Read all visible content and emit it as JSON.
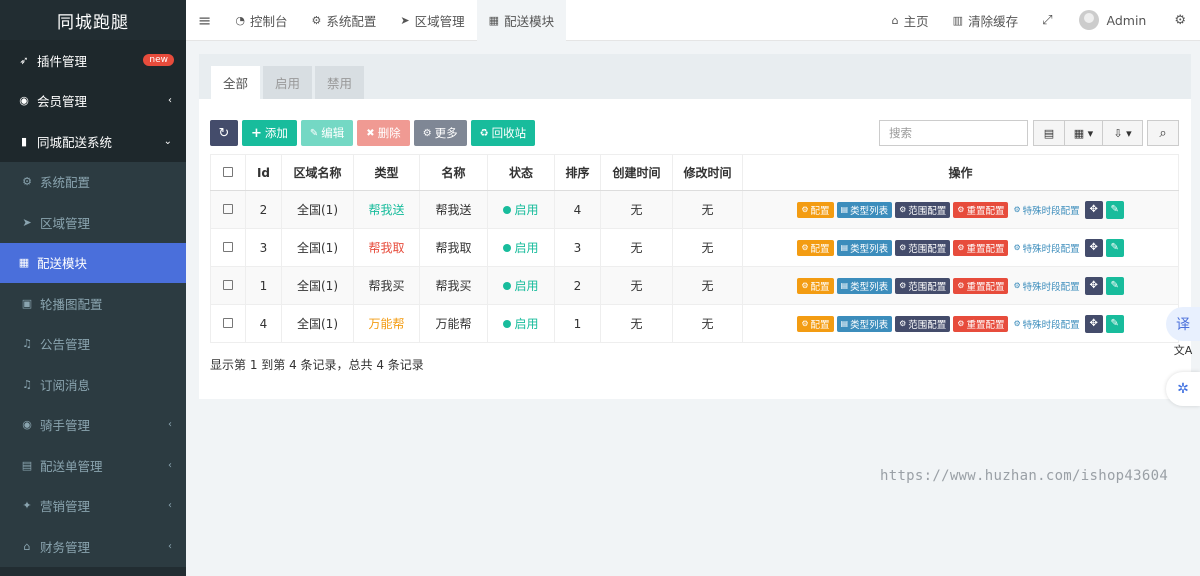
{
  "sidebar": {
    "brand": "同城跑腿",
    "items": [
      {
        "label": "插件管理",
        "icon": "rocket-icon",
        "glyph": "➶",
        "badge": "new",
        "kind": "top"
      },
      {
        "label": "会员管理",
        "icon": "user-circle-icon",
        "glyph": "◉",
        "arrow": "‹",
        "kind": "top"
      },
      {
        "label": "同城配送系统",
        "icon": "mobile-icon",
        "glyph": "▮",
        "arrow": "⌄",
        "kind": "top"
      },
      {
        "label": "系统配置",
        "icon": "gears-icon",
        "glyph": "⚙",
        "kind": "sub"
      },
      {
        "label": "区域管理",
        "icon": "location-arrow-icon",
        "glyph": "➤",
        "kind": "sub"
      },
      {
        "label": "配送模块",
        "icon": "grid-icon",
        "glyph": "▦",
        "kind": "active"
      },
      {
        "label": "轮播图配置",
        "icon": "image-icon",
        "glyph": "▣",
        "kind": "sub"
      },
      {
        "label": "公告管理",
        "icon": "bell-icon",
        "glyph": "♫",
        "kind": "sub"
      },
      {
        "label": "订阅消息",
        "icon": "bell-icon",
        "glyph": "♫",
        "kind": "sub"
      },
      {
        "label": "骑手管理",
        "icon": "user-circle-icon",
        "glyph": "◉",
        "arrow": "‹",
        "kind": "sub"
      },
      {
        "label": "配送单管理",
        "icon": "list-alt-icon",
        "glyph": "▤",
        "arrow": "‹",
        "kind": "sub"
      },
      {
        "label": "营销管理",
        "icon": "gift-icon",
        "glyph": "✦",
        "arrow": "‹",
        "kind": "sub"
      },
      {
        "label": "财务管理",
        "icon": "bank-icon",
        "glyph": "⌂",
        "arrow": "‹",
        "kind": "sub"
      }
    ]
  },
  "topbar": {
    "menu_glyph": "≡",
    "tabs": [
      {
        "label": "控制台",
        "icon": "dashboard-icon",
        "glyph": "◔"
      },
      {
        "label": "系统配置",
        "icon": "gears-icon",
        "glyph": "⚙"
      },
      {
        "label": "区域管理",
        "icon": "location-arrow-icon",
        "glyph": "➤"
      },
      {
        "label": "配送模块",
        "icon": "grid-icon",
        "glyph": "▦",
        "active": true
      }
    ],
    "home_label": "主页",
    "home_glyph": "⌂",
    "clear_cache_label": "清除缓存",
    "clear_cache_glyph": "▥",
    "fullscreen_glyph": "⤢",
    "user_name": "Admin",
    "settings_glyph": "⚙"
  },
  "filter_tabs": [
    "全部",
    "启用",
    "禁用"
  ],
  "toolbar": {
    "refresh_glyph": "↻",
    "add_label": "添加",
    "add_glyph": "+",
    "edit_label": "编辑",
    "edit_glyph": "✎",
    "delete_label": "删除",
    "delete_glyph": "✖",
    "more_label": "更多",
    "more_glyph": "⚙",
    "recycle_label": "回收站",
    "recycle_glyph": "♻",
    "search_placeholder": "搜索",
    "toggle_view_glyph": "▤",
    "columns_glyph": "▦ ▾",
    "export_glyph": "⇩ ▾",
    "search_glyph": "⌕"
  },
  "table": {
    "headers": [
      "Id",
      "区域名称",
      "类型",
      "名称",
      "状态",
      "排序",
      "创建时间",
      "修改时间",
      "操作"
    ],
    "rows": [
      {
        "id": "2",
        "region": "全国(1)",
        "type": "帮我送",
        "type_color": "green",
        "name": "帮我送",
        "status": "启用",
        "sort": "4",
        "created": "无",
        "modified": "无"
      },
      {
        "id": "3",
        "region": "全国(1)",
        "type": "帮我取",
        "type_color": "red",
        "name": "帮我取",
        "status": "启用",
        "sort": "3",
        "created": "无",
        "modified": "无"
      },
      {
        "id": "1",
        "region": "全国(1)",
        "type": "帮我买",
        "type_color": "plain",
        "name": "帮我买",
        "status": "启用",
        "sort": "2",
        "created": "无",
        "modified": "无"
      },
      {
        "id": "4",
        "region": "全国(1)",
        "type": "万能帮",
        "type_color": "orange",
        "name": "万能帮",
        "status": "启用",
        "sort": "1",
        "created": "无",
        "modified": "无"
      }
    ],
    "ops": {
      "config": "配置",
      "type_list": "类型列表",
      "scope_config": "范围配置",
      "reset_config": "重置配置",
      "special_period": "特殊时段配置",
      "config_glyph": "⚙",
      "list_glyph": "▤",
      "scope_glyph": "⚙",
      "reset_glyph": "⚙",
      "special_glyph": "⚙",
      "move_glyph": "✥",
      "edit_glyph": "✎"
    }
  },
  "pager_text": "显示第 1 到第 4 条记录，总共 4 条记录",
  "watermark": "https://www.huzhan.com/ishop43604",
  "float_buttons": {
    "translate": "译",
    "translate2": "文A",
    "ai": "✲"
  },
  "colors": {
    "sidebar_bg": "#222d32",
    "active": "#4a6fdb",
    "success": "#18bc9c",
    "danger": "#e74c3c",
    "warning": "#f39c12",
    "info": "#3c8dbc"
  }
}
